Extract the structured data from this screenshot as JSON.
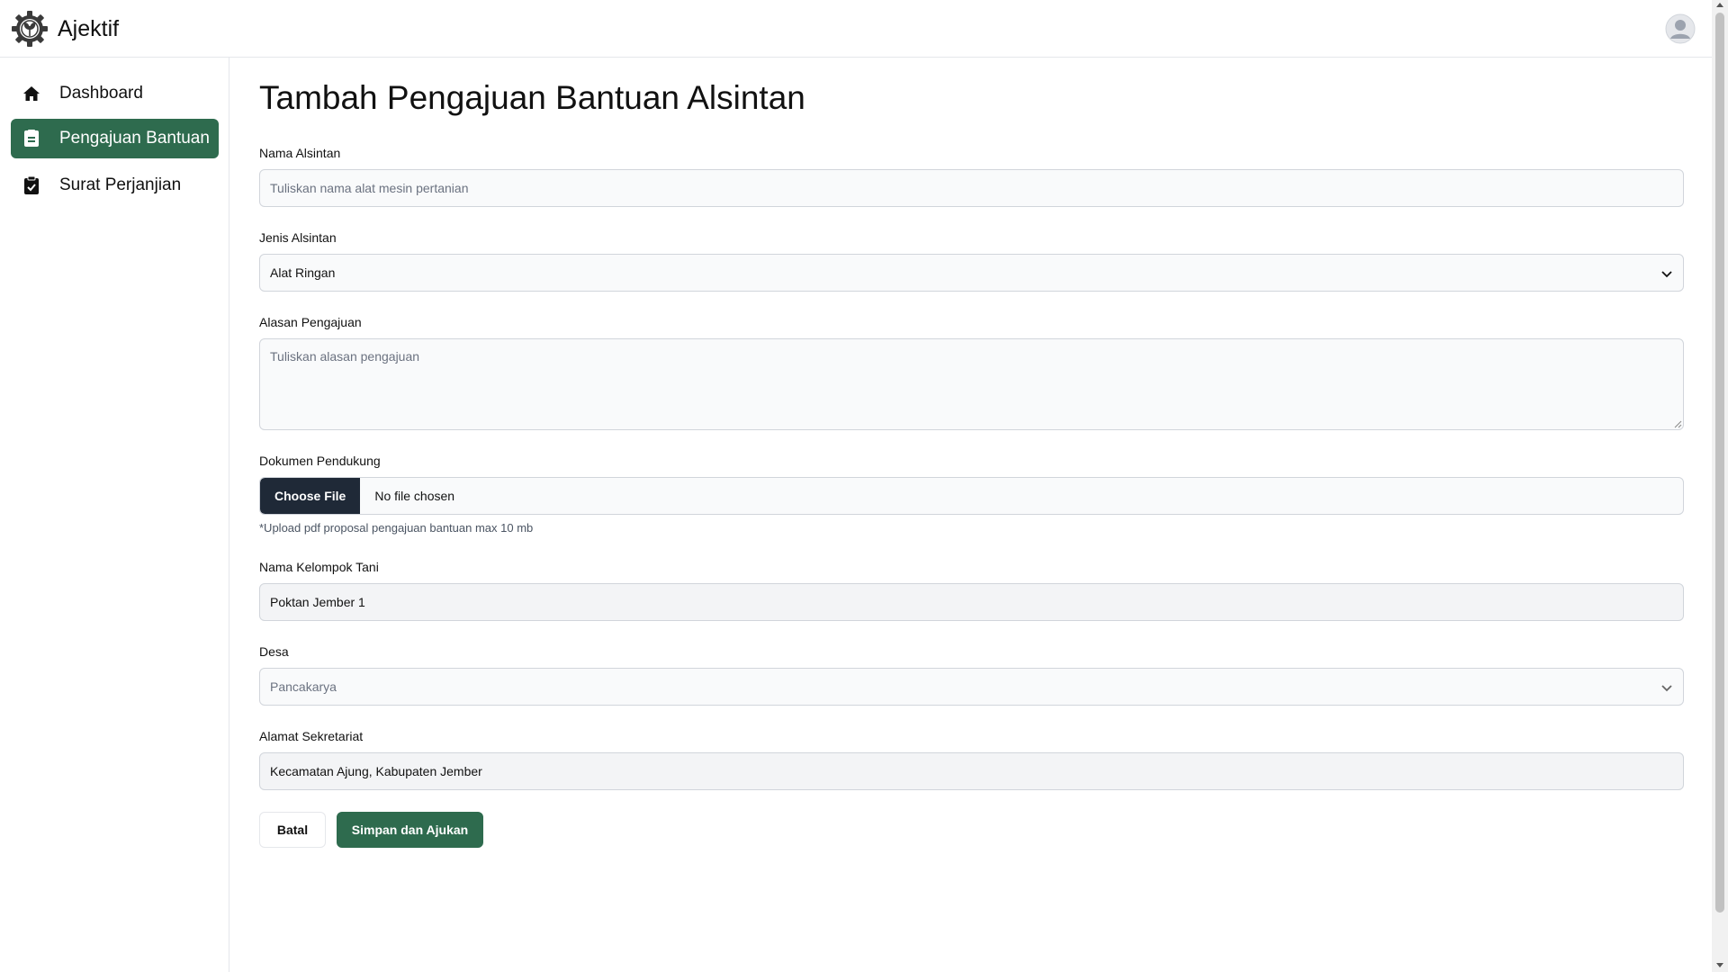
{
  "app": {
    "name": "Ajektif"
  },
  "colors": {
    "primary": "#2e6b4e",
    "file_button": "#1f2937",
    "border": "#d1d5db"
  },
  "sidebar": {
    "items": [
      {
        "label": "Dashboard",
        "icon": "home-icon",
        "active": false
      },
      {
        "label": "Pengajuan Bantuan",
        "icon": "document-icon",
        "active": true
      },
      {
        "label": "Surat Perjanjian",
        "icon": "clipboard-check-icon",
        "active": false
      }
    ]
  },
  "page": {
    "title": "Tambah Pengajuan Bantuan Alsintan"
  },
  "form": {
    "nama_alsintan": {
      "label": "Nama Alsintan",
      "placeholder": "Tuliskan nama alat mesin pertanian",
      "value": ""
    },
    "jenis_alsintan": {
      "label": "Jenis Alsintan",
      "value": "Alat Ringan"
    },
    "alasan_pengajuan": {
      "label": "Alasan Pengajuan",
      "placeholder": "Tuliskan alasan pengajuan",
      "value": ""
    },
    "dokumen_pendukung": {
      "label": "Dokumen Pendukung",
      "button_label": "Choose File",
      "status": "No file chosen",
      "helper": "*Upload pdf proposal pengajuan bantuan max 10 mb"
    },
    "nama_kelompok_tani": {
      "label": "Nama Kelompok Tani",
      "value": "Poktan Jember 1"
    },
    "desa": {
      "label": "Desa",
      "value": "Pancakarya"
    },
    "alamat_sekretariat": {
      "label": "Alamat Sekretariat",
      "value": "Kecamatan Ajung, Kabupaten Jember"
    },
    "actions": {
      "cancel_label": "Batal",
      "submit_label": "Simpan dan Ajukan"
    }
  }
}
